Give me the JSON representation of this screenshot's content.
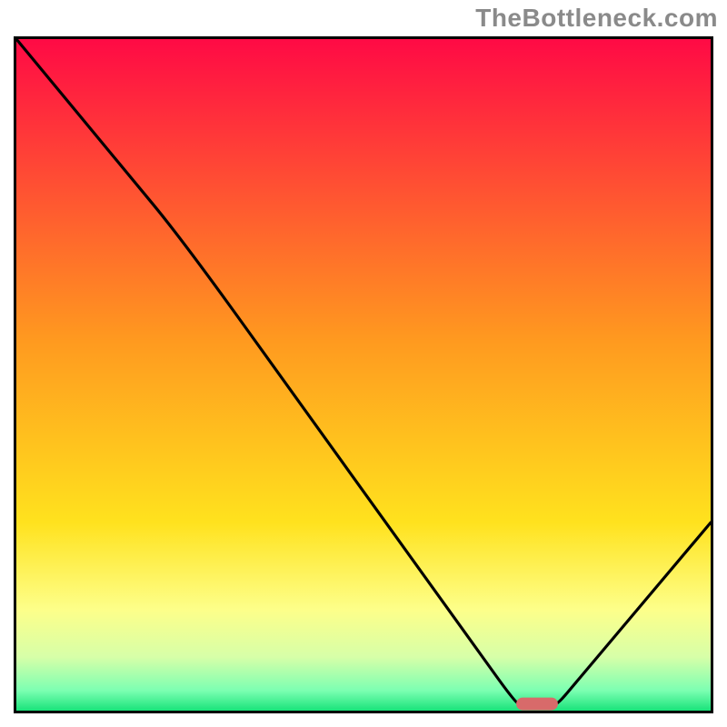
{
  "watermark": "TheBottleneck.com",
  "chart_data": {
    "type": "line",
    "title": "",
    "xlabel": "",
    "ylabel": "",
    "xlim": [
      0,
      100
    ],
    "ylim": [
      0,
      100
    ],
    "grid": false,
    "legend": false,
    "series": [
      {
        "name": "bottleneck-curve",
        "x": [
          0,
          24,
          72,
          78,
          100
        ],
        "y": [
          100,
          70,
          1,
          1,
          28
        ]
      }
    ],
    "marker": {
      "name": "sweet-spot",
      "x_start": 72,
      "x_end": 78,
      "y": 1
    },
    "gradient_stops": [
      {
        "pos": 0.0,
        "color": "#ff0a45"
      },
      {
        "pos": 0.45,
        "color": "#ff9a1f"
      },
      {
        "pos": 0.72,
        "color": "#ffe21e"
      },
      {
        "pos": 0.85,
        "color": "#fdff8a"
      },
      {
        "pos": 0.92,
        "color": "#d7ffa8"
      },
      {
        "pos": 0.97,
        "color": "#7cffb2"
      },
      {
        "pos": 1.0,
        "color": "#19e37a"
      }
    ],
    "frame_color": "#000000",
    "curve_color": "#000000",
    "marker_color": "#d86a6a"
  }
}
